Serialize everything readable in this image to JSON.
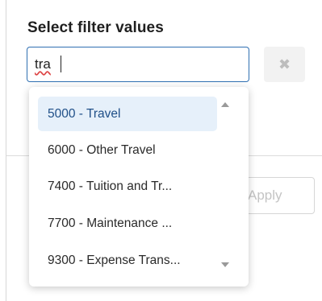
{
  "filter_panel": {
    "title": "Select filter values",
    "search_value": "tra",
    "clear_label": "✖",
    "apply_label": "Apply"
  },
  "dropdown": {
    "options": [
      {
        "label": "5000 - Travel",
        "selected": true
      },
      {
        "label": "6000 - Other Travel",
        "selected": false
      },
      {
        "label": "7400 - Tuition and Tr...",
        "selected": false
      },
      {
        "label": "7700 - Maintenance ...",
        "selected": false
      },
      {
        "label": "9300 - Expense Trans...",
        "selected": false
      }
    ]
  },
  "icons": {
    "clear": "close-icon",
    "scroll_up": "scroll-up-arrow-icon",
    "scroll_down": "scroll-down-arrow-icon"
  },
  "colors": {
    "focus_border": "#2f6fb2",
    "selected_bg": "#e6f0fa",
    "disabled_text": "#c4c4c4"
  }
}
